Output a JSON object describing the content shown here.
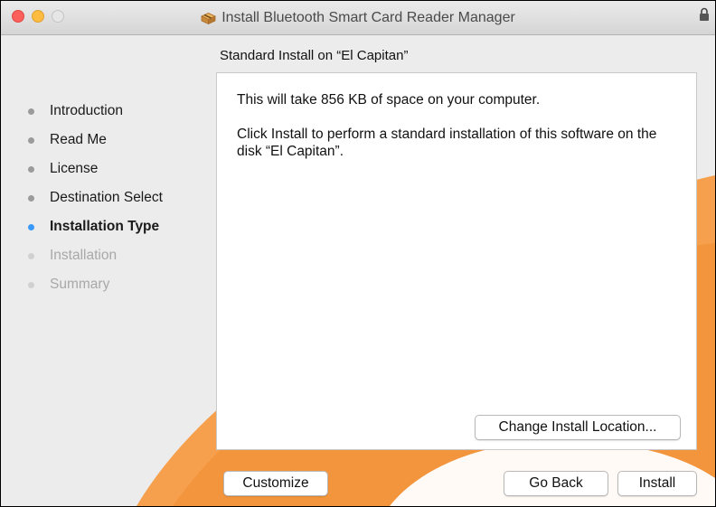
{
  "window": {
    "title": "Install Bluetooth Smart Card Reader Manager"
  },
  "header": {
    "subtitle": "Standard Install on “El Capitan”"
  },
  "sidebar": {
    "steps": [
      {
        "label": "Introduction",
        "state": "done"
      },
      {
        "label": "Read Me",
        "state": "done"
      },
      {
        "label": "License",
        "state": "done"
      },
      {
        "label": "Destination Select",
        "state": "done"
      },
      {
        "label": "Installation Type",
        "state": "current"
      },
      {
        "label": "Installation",
        "state": "future"
      },
      {
        "label": "Summary",
        "state": "future"
      }
    ]
  },
  "main": {
    "space_text": "This will take 856 KB of space on your computer.",
    "instruction_text": "Click Install to perform a standard installation of this software on the disk “El Capitan”.",
    "change_location_label": "Change Install Location..."
  },
  "footer": {
    "customize_label": "Customize",
    "go_back_label": "Go Back",
    "install_label": "Install"
  },
  "colors": {
    "accent_current_step": "#3b99fc",
    "background_art": "#f6a04d"
  },
  "icons": {
    "title_icon": "package-icon",
    "lock": "lock-icon"
  }
}
